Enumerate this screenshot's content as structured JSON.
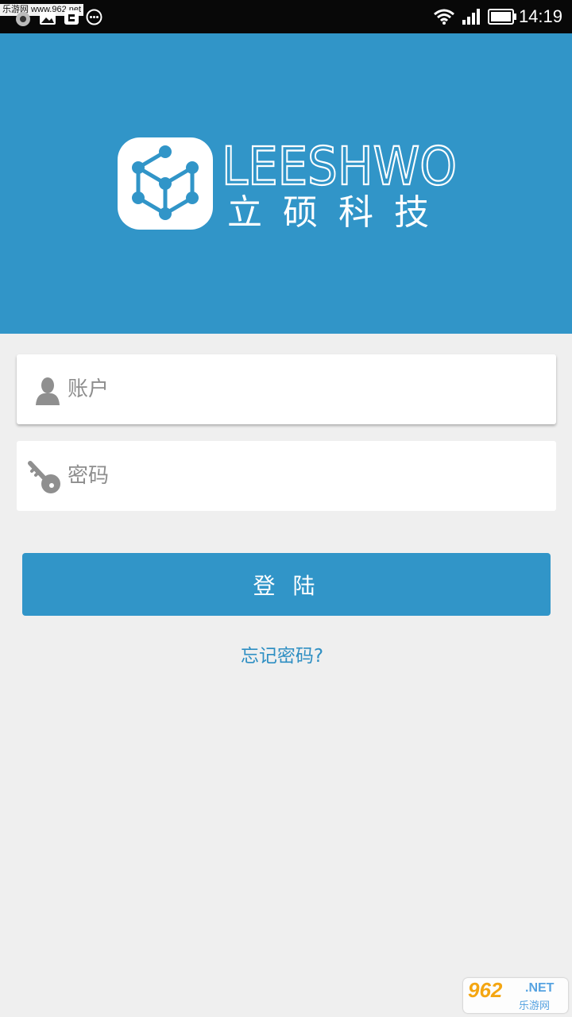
{
  "status_bar": {
    "watermark_text": "乐游网 www.962.net",
    "time": "14:19",
    "icons": [
      "app-icon",
      "image-icon",
      "notification-icon",
      "more-icon",
      "wifi-icon",
      "signal-icon",
      "battery-icon"
    ]
  },
  "header": {
    "brand_en": "LEESHWO",
    "brand_cn": "立硕科技",
    "logo_icon": "cube-network-icon",
    "background_color": "#3195c8"
  },
  "form": {
    "account": {
      "placeholder": "账户",
      "value": "",
      "icon": "user-icon"
    },
    "password": {
      "placeholder": "密码",
      "value": "",
      "icon": "key-icon"
    },
    "login_label": "登陆",
    "forgot_label": "忘记密码?"
  },
  "watermark": {
    "number": "962",
    "net": ".NET",
    "cn": "乐游网"
  },
  "colors": {
    "accent": "#3195c8",
    "link": "#2f8fc3",
    "page_bg": "#efefef"
  }
}
